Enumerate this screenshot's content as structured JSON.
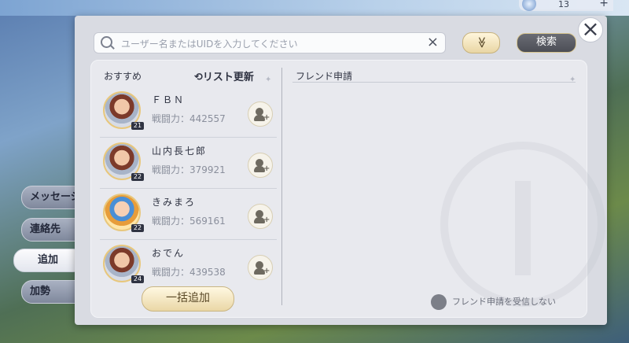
{
  "hud": {
    "resource_count": "13",
    "plus": "+"
  },
  "sidebar": {
    "tabs": [
      {
        "label": "メッセージ"
      },
      {
        "label": "連絡先"
      },
      {
        "label": "追加"
      },
      {
        "label": "加勢"
      }
    ]
  },
  "search": {
    "placeholder": "ユーザー名またはUIDを入力してください",
    "clear": "×",
    "dropdown": "≫",
    "button": "検索"
  },
  "close": "×",
  "recommend": {
    "title": "おすすめ",
    "refresh": "リスト更新",
    "items": [
      {
        "name": "ＦＢＮ",
        "level": "21",
        "power": "戦闘力：442557"
      },
      {
        "name": "山内長七郎",
        "level": "22",
        "power": "戦闘力：379921"
      },
      {
        "name": "きみまろ",
        "level": "22",
        "power": "戦闘力：569161"
      },
      {
        "name": "おでん",
        "level": "24",
        "power": "戦闘力：439538"
      }
    ],
    "bulk_add": "一括追加"
  },
  "friend_requests": {
    "title": "フレンド申請",
    "reject_label": "フレンド申請を受信しない"
  }
}
